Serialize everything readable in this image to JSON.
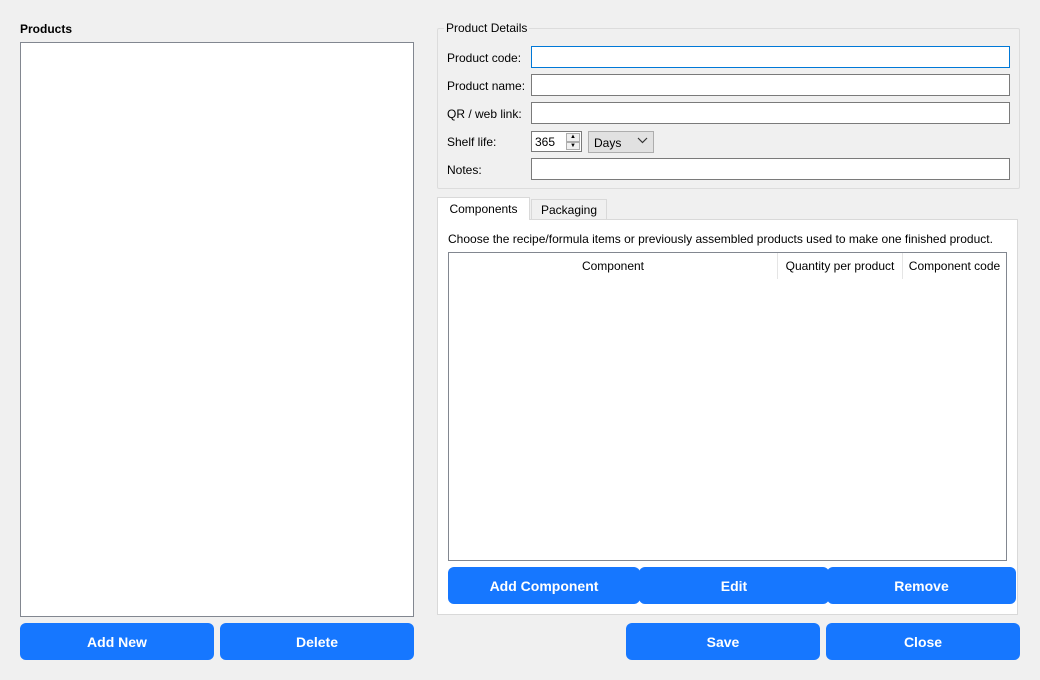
{
  "products": {
    "title": "Products",
    "items": [],
    "add_new_label": "Add New",
    "delete_label": "Delete"
  },
  "details": {
    "legend": "Product Details",
    "product_code_label": "Product code:",
    "product_code_value": "",
    "product_name_label": "Product name:",
    "product_name_value": "",
    "qr_label": "QR / web link:",
    "qr_value": "",
    "shelf_life_label": "Shelf life:",
    "shelf_life_value": "365",
    "shelf_life_unit": "Days",
    "notes_label": "Notes:",
    "notes_value": ""
  },
  "tabs": [
    {
      "label": "Components",
      "active": true
    },
    {
      "label": "Packaging",
      "active": false
    }
  ],
  "components": {
    "description": "Choose the recipe/formula items or previously assembled products used to make one finished product.",
    "columns": [
      "Component",
      "Quantity per product",
      "Component code"
    ],
    "rows": [],
    "add_label": "Add Component",
    "edit_label": "Edit",
    "remove_label": "Remove"
  },
  "footer": {
    "save_label": "Save",
    "close_label": "Close"
  },
  "colors": {
    "accent": "#1677ff",
    "focus_border": "#0078d7",
    "background": "#f0f0f0"
  }
}
